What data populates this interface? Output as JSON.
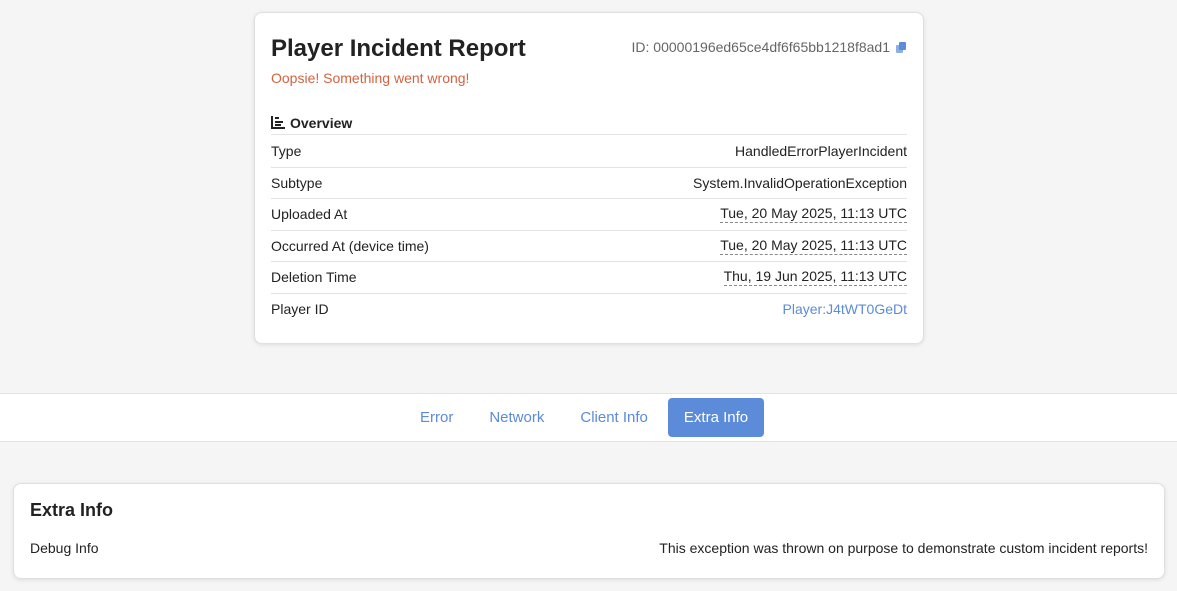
{
  "report": {
    "title": "Player Incident Report",
    "subtitle": "Oopsie! Something went wrong!",
    "id_label": "ID: 00000196ed65ce4df6f65bb1218f8ad1"
  },
  "overview": {
    "heading": "Overview",
    "rows": [
      {
        "label": "Type",
        "value": "HandledErrorPlayerIncident"
      },
      {
        "label": "Subtype",
        "value": "System.InvalidOperationException"
      },
      {
        "label": "Uploaded At",
        "value": "Tue, 20 May 2025, 11:13 UTC"
      },
      {
        "label": "Occurred At (device time)",
        "value": "Tue, 20 May 2025, 11:13 UTC"
      },
      {
        "label": "Deletion Time",
        "value": "Thu, 19 Jun 2025, 11:13 UTC"
      },
      {
        "label": "Player ID",
        "value": "Player:J4tWT0GeDt"
      }
    ]
  },
  "tabs": [
    {
      "label": "Error"
    },
    {
      "label": "Network"
    },
    {
      "label": "Client Info"
    },
    {
      "label": "Extra Info"
    }
  ],
  "extra_info": {
    "heading": "Extra Info",
    "debug_label": "Debug Info",
    "debug_value": "This exception was thrown on purpose to demonstrate custom incident reports!"
  },
  "colors": {
    "accent": "#5b8bd9",
    "error_text": "#d4623f"
  }
}
